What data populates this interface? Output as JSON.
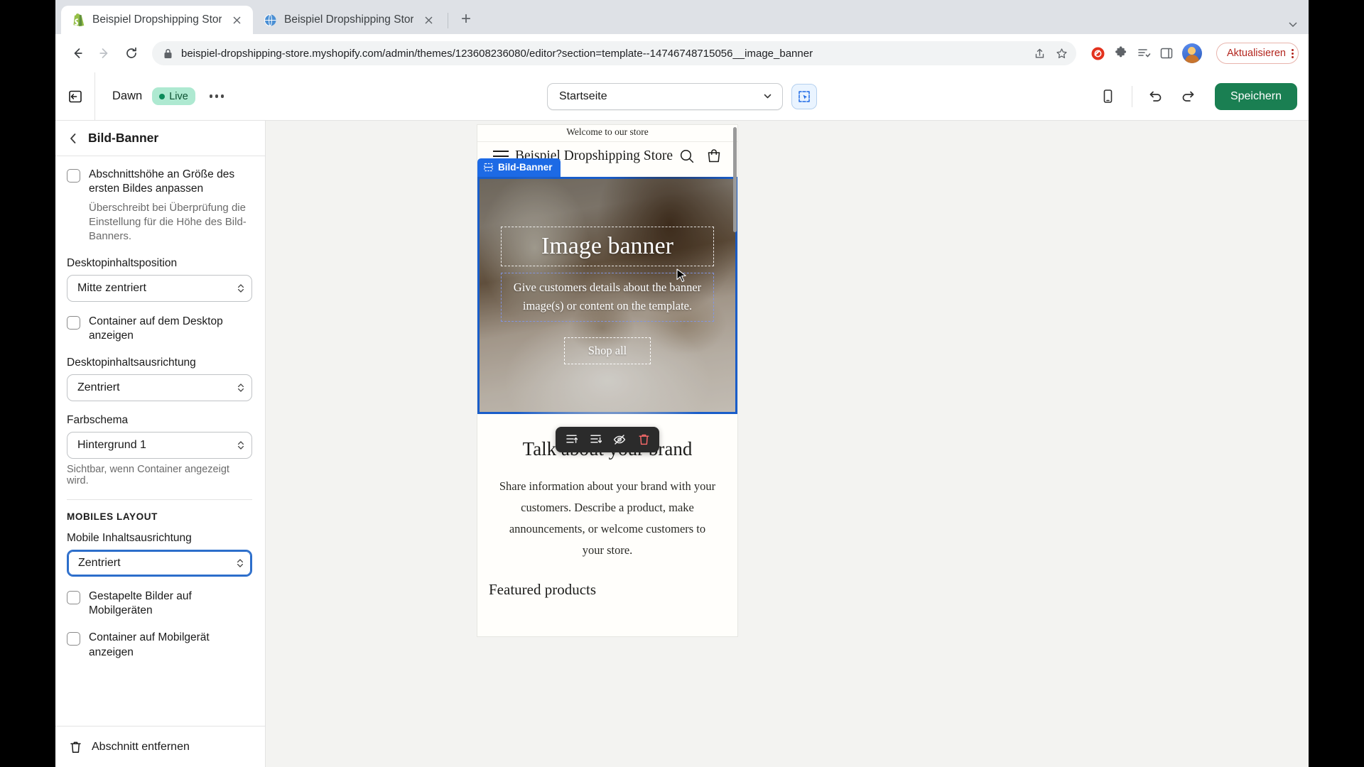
{
  "browser": {
    "tabs": [
      {
        "title": "Beispiel Dropshipping Store · D",
        "favicon": "shopify-icon",
        "active": true
      },
      {
        "title": "Beispiel Dropshipping Store",
        "favicon": "globe-icon",
        "active": false
      }
    ],
    "newtab_label": "+",
    "url": "beispiel-dropshipping-store.myshopify.com/admin/themes/123608236080/editor?section=template--14746748715056__image_banner",
    "update_label": "Aktualisieren",
    "icons": {
      "back": "back-arrow-icon",
      "forward": "forward-arrow-icon",
      "reload": "reload-icon",
      "lock": "lock-icon",
      "share": "share-icon",
      "bookmark": "star-icon",
      "adblock": "adblock-icon",
      "extensions": "puzzle-icon",
      "readinglist": "reading-list-icon",
      "sidepanel": "side-panel-icon",
      "profile": "avatar-icon",
      "tabsearch": "chevron-down-icon"
    }
  },
  "editor": {
    "topbar": {
      "exit_label": "exit-icon",
      "theme_name": "Dawn",
      "live_label": "Live",
      "more_label": "…",
      "page_selector": "Startseite",
      "inspect_label": "inspector-icon",
      "device_label": "mobile-preview-icon",
      "undo_label": "undo-icon",
      "redo_label": "redo-icon",
      "save_label": "Speichern"
    },
    "sidebar": {
      "title": "Bild-Banner",
      "back_label": "‹",
      "fields": [
        {
          "type": "checkbox",
          "label": "Abschnittshöhe an Größe des ersten Bildes anpassen",
          "checked": false,
          "help": "Überschreibt bei Überprüfung die Einstellung für die Höhe des Bild-Banners."
        },
        {
          "type": "select",
          "label": "Desktopinhaltsposition",
          "value": "Mitte zentriert"
        },
        {
          "type": "checkbox",
          "label": "Container auf dem Desktop anzeigen",
          "checked": false
        },
        {
          "type": "select",
          "label": "Desktopinhaltsausrichtung",
          "value": "Zentriert"
        },
        {
          "type": "select",
          "label": "Farbschema",
          "value": "Hintergrund 1",
          "note": "Sichtbar, wenn Container angezeigt wird."
        }
      ],
      "mobile_section": {
        "caption": "MOBILES LAYOUT",
        "align_label": "Mobile Inhaltsausrichtung",
        "align_value": "Zentriert",
        "align_focused": true,
        "checkboxes": [
          {
            "label": "Gestapelte Bilder auf Mobilgeräten",
            "checked": false
          },
          {
            "label": "Container auf Mobilgerät anzeigen",
            "checked": false
          }
        ]
      },
      "footer": {
        "remove_label": "Abschnitt entfernen",
        "remove_icon": "trash-icon"
      }
    },
    "preview": {
      "announcement": "Welcome to our store",
      "store_name": "Beispiel Dropshipping Store",
      "header_icons": {
        "menu": "hamburger-icon",
        "search": "search-icon",
        "cart": "cart-icon"
      },
      "section_tag": "Bild-Banner",
      "section_tag_icon": "section-icon",
      "banner": {
        "heading": "Image banner",
        "paragraph": "Give customers details about the banner image(s) or content on the template.",
        "button": "Shop all"
      },
      "float_toolbar": [
        {
          "icon": "move-up-icon",
          "name": "move-up-button"
        },
        {
          "icon": "duplicate-icon",
          "name": "duplicate-button"
        },
        {
          "icon": "hide-icon",
          "name": "hide-button"
        },
        {
          "icon": "trash-icon",
          "name": "delete-button"
        }
      ],
      "content": {
        "heading": "Talk about your brand",
        "paragraph": "Share information about your brand with your customers. Describe a product, make announcements, or welcome customers to your store.",
        "featured": "Featured products"
      }
    }
  }
}
